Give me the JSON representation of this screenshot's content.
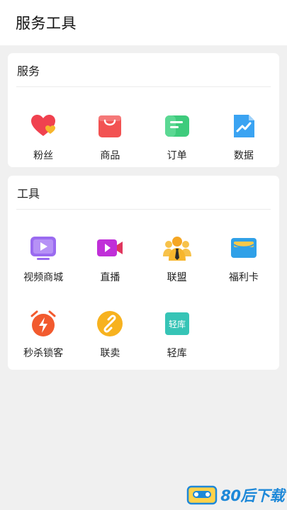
{
  "header": {
    "title": "服务工具"
  },
  "service": {
    "title": "服务",
    "items": [
      {
        "label": "粉丝",
        "icon": "heart-icon"
      },
      {
        "label": "商品",
        "icon": "shopping-bag-icon"
      },
      {
        "label": "订单",
        "icon": "order-list-icon"
      },
      {
        "label": "数据",
        "icon": "data-chart-icon"
      }
    ]
  },
  "tools": {
    "title": "工具",
    "items": [
      {
        "label": "视频商城",
        "icon": "video-tv-icon"
      },
      {
        "label": "直播",
        "icon": "video-camera-icon"
      },
      {
        "label": "联盟",
        "icon": "people-alliance-icon"
      },
      {
        "label": "福利卡",
        "icon": "welfare-card-icon"
      },
      {
        "label": "秒杀锁客",
        "icon": "alarm-clock-flash-icon"
      },
      {
        "label": "联卖",
        "icon": "link-chain-icon"
      },
      {
        "label": "轻库",
        "icon": "light-warehouse-icon",
        "icon_text": "轻库"
      }
    ]
  },
  "watermark": {
    "text": "80后下载"
  },
  "colors": {
    "background": "#f0f0f0",
    "card": "#ffffff",
    "heart": "#f0414f",
    "bag": "#f25252",
    "order": "#3ecb7c",
    "data": "#3aa3f2",
    "video_tv": "#9a6bf0",
    "camera": "#c02fd8",
    "alliance": "#f7b62d",
    "welfare": "#2fa0e8",
    "alarm": "#f25a2e",
    "link": "#f7b21f",
    "warehouse": "#36c4b6"
  }
}
